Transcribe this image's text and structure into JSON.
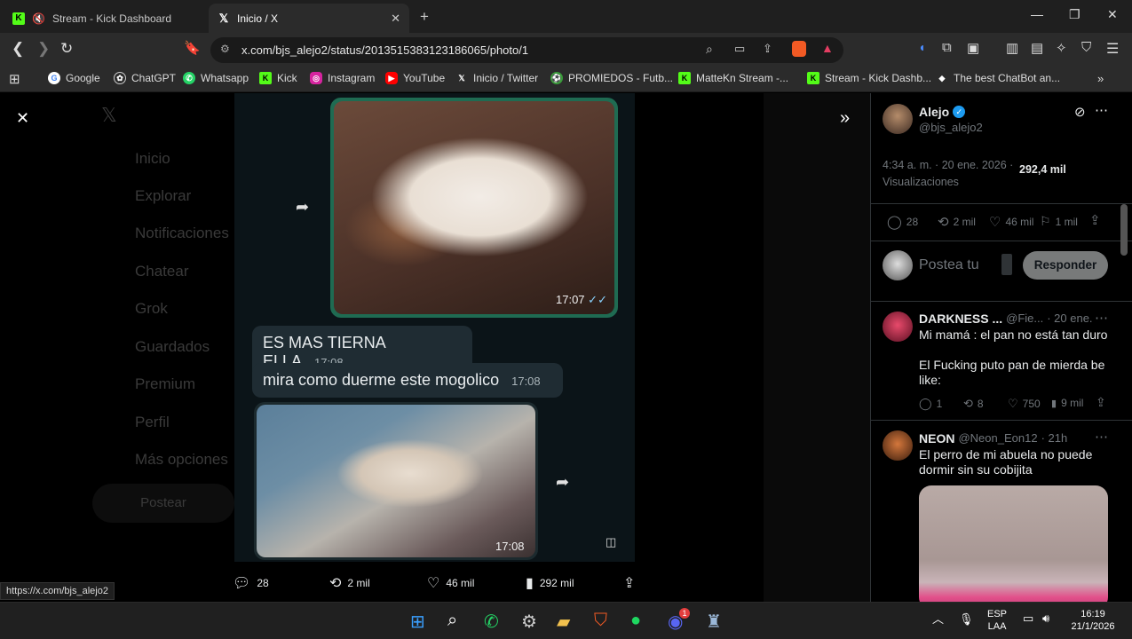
{
  "tabs": [
    {
      "title": "Stream - Kick Dashboard",
      "icon": "kick-icon",
      "muted": true
    },
    {
      "title": "Inicio / X",
      "icon": "x-logo-icon"
    }
  ],
  "url": "x.com/bjs_alejo2/status/2013515383123186065/photo/1",
  "bookmarks": [
    {
      "label": "Google"
    },
    {
      "label": "ChatGPT"
    },
    {
      "label": "Whatsapp"
    },
    {
      "label": "Kick"
    },
    {
      "label": "Instagram"
    },
    {
      "label": "YouTube"
    },
    {
      "label": "Inicio / Twitter"
    },
    {
      "label": "PROMIEDOS - Futb..."
    },
    {
      "label": "MatteKn Stream -..."
    },
    {
      "label": "Stream - Kick Dashb..."
    },
    {
      "label": "The best ChatBot an..."
    }
  ],
  "dim_nav": [
    "Inicio",
    "Explorar",
    "Notificaciones",
    "Chatear",
    "Grok",
    "Guardados",
    "Premium",
    "Perfil",
    "Más opciones",
    "Postear"
  ],
  "photo": {
    "img1_time": "17:07",
    "messages": [
      {
        "text": "ES MAS TIERNA ELLA",
        "time": "17:08"
      },
      {
        "text": "mira como duerme este mogolico",
        "time": "17:08"
      }
    ],
    "img2_time": "17:08"
  },
  "photo_actions": {
    "replies": "28",
    "reposts": "2 mil",
    "likes": "46 mil",
    "views": "292 mil"
  },
  "status_url": "https://x.com/bjs_alejo2",
  "sidebar": {
    "author": {
      "name": "Alejo",
      "handle": "@bjs_alejo2"
    },
    "meta": "4:34 a. m. · 20 ene. 2026 ·",
    "views_count": "292,4 mil",
    "views_label": "Visualizaciones",
    "stats": {
      "replies": "28",
      "reposts": "2 mil",
      "likes": "46 mil",
      "bookmarks": "1 mil"
    },
    "reply_placeholder": "Postea tu",
    "reply_button": "Responder",
    "replies": [
      {
        "name": "DARKNESS ...",
        "handle": "@Fie...",
        "time": "· 20 ene.",
        "line1": "Mi mamá : el pan no está tan duro",
        "line2": "El Fucking puto pan de mierda be like:",
        "stats": {
          "replies": "1",
          "reposts": "8",
          "likes": "750",
          "views": "9 mil"
        }
      },
      {
        "name": "NEON",
        "handle": "@Neon_Eon12",
        "time": "· 21h",
        "line1": "El perro de mi abuela no puede dormir sin su cobijita"
      }
    ]
  },
  "tray": {
    "lang": "ESP",
    "layout": "LAA",
    "time": "16:19",
    "date": "21/1/2026",
    "discord_badge": "1"
  }
}
